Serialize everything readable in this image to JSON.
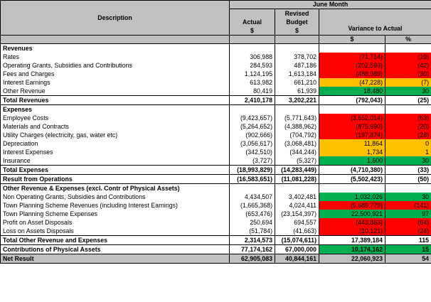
{
  "header": {
    "period": "June Month",
    "description": "Description",
    "actual": "Actual",
    "actual_unit": "$",
    "revised": "Revised",
    "budget": "Budget",
    "budget_unit": "$",
    "variance": "Variance to Actual",
    "var_dollar": "$",
    "var_pct": "%"
  },
  "colors": {
    "red": "#ff0000",
    "amber": "#ffc000",
    "green": "#00b050",
    "header_gray": "#c0c0c0"
  },
  "rows": [
    {
      "type": "section",
      "desc": "Revenues",
      "actual": "",
      "budget": "",
      "var": "",
      "pct": ""
    },
    {
      "type": "item",
      "desc": "Rates",
      "actual": "306,988",
      "budget": "378,702",
      "var": "(71,714)",
      "pct": "(19)",
      "status": "red"
    },
    {
      "type": "item",
      "desc": "Operating Grants, Subsidies and Contributions",
      "actual": "284,593",
      "budget": "487,186",
      "var": "(202,593)",
      "pct": "(42)",
      "status": "red"
    },
    {
      "type": "item",
      "desc": "Fees and Charges",
      "actual": "1,124,195",
      "budget": "1,613,184",
      "var": "(488,989)",
      "pct": "(30)",
      "status": "red"
    },
    {
      "type": "item",
      "desc": "Interest Earnings",
      "actual": "613,982",
      "budget": "661,210",
      "var": "(47,228)",
      "pct": "(7)",
      "status": "amber"
    },
    {
      "type": "item",
      "desc": "Other Revenue",
      "actual": "80,419",
      "budget": "61,939",
      "var": "18,480",
      "pct": "30",
      "status": "green"
    },
    {
      "type": "total",
      "desc": "Total Revenues",
      "actual": "2,410,178",
      "budget": "3,202,221",
      "var": "(792,043)",
      "pct": "(25)"
    },
    {
      "type": "section",
      "desc": "Expenses",
      "actual": "",
      "budget": "",
      "var": "",
      "pct": ""
    },
    {
      "type": "item",
      "desc": "Employee Costs",
      "actual": "(9,423,657)",
      "budget": "(5,771,643)",
      "var": "(3,652,014)",
      "pct": "(63)",
      "status": "red"
    },
    {
      "type": "item",
      "desc": "Materials and Contracts",
      "actual": "(5,264,652)",
      "budget": "(4,388,962)",
      "var": "(875,690)",
      "pct": "(20)",
      "status": "red"
    },
    {
      "type": "item",
      "desc": "Utility Charges (electricity, gas, water etc)",
      "actual": "(902,666)",
      "budget": "(704,792)",
      "var": "(197,874)",
      "pct": "(28)",
      "status": "red"
    },
    {
      "type": "item",
      "desc": "Depreciation",
      "actual": "(3,056,617)",
      "budget": "(3,068,481)",
      "var": "11,864",
      "pct": "0",
      "status": "amber"
    },
    {
      "type": "item",
      "desc": "Interest Expenses",
      "actual": "(342,510)",
      "budget": "(344,244)",
      "var": "1,734",
      "pct": "1",
      "status": "amber"
    },
    {
      "type": "item",
      "desc": "Insurance",
      "actual": "(3,727)",
      "budget": "(5,327)",
      "var": "1,600",
      "pct": "30",
      "status": "green"
    },
    {
      "type": "total",
      "desc": "Total Expenses",
      "actual": "(18,993,829)",
      "budget": "(14,283,449)",
      "var": "(4,710,380)",
      "pct": "(33)"
    },
    {
      "type": "total",
      "desc": "Result from Operations",
      "actual": "(16,583,651)",
      "budget": "(11,081,228)",
      "var": "(5,502,423)",
      "pct": "(50)"
    },
    {
      "type": "section",
      "desc": "Other Revenue & Expenses (excl. Contr of Physical Assets)",
      "actual": "",
      "budget": "",
      "var": "",
      "pct": ""
    },
    {
      "type": "item",
      "desc": "Non Operating Grants, Subsidies and Contributions",
      "actual": "4,434,507",
      "budget": "3,402,481",
      "var": "1,032,026",
      "pct": "30",
      "status": "green"
    },
    {
      "type": "item",
      "desc": "Town Planning Scheme Revenues (including Interest Earnings)",
      "actual": "(1,665,368)",
      "budget": "4,024,411",
      "var": "(5,689,779)",
      "pct": "(141)",
      "status": "red"
    },
    {
      "type": "item",
      "desc": "Town Planning Scheme Expenses",
      "actual": "(653,476)",
      "budget": "(23,154,397)",
      "var": "22,500,921",
      "pct": "97",
      "status": "green"
    },
    {
      "type": "item",
      "desc": "Profit on Asset Disposals",
      "actual": "250,694",
      "budget": "694,557",
      "var": "(443,863)",
      "pct": "(64)",
      "status": "red"
    },
    {
      "type": "item",
      "desc": "Loss on Assets Disposals",
      "actual": "(51,784)",
      "budget": "(41,663)",
      "var": "(10,121)",
      "pct": "(24)",
      "status": "red"
    },
    {
      "type": "total",
      "desc": "Total Other Revenue and Expenses",
      "actual": "2,314,573",
      "budget": "(15,074,611)",
      "var": "17,389,184",
      "pct": "115"
    },
    {
      "type": "total",
      "desc": "Contributions of Physical Assets",
      "actual": "77,174,162",
      "budget": "67,000,000",
      "var": "10,174,162",
      "pct": "15",
      "status": "green"
    },
    {
      "type": "net",
      "desc": "Net Result",
      "actual": "62,905,083",
      "budget": "40,844,161",
      "var": "22,060,923",
      "pct": "54"
    }
  ]
}
